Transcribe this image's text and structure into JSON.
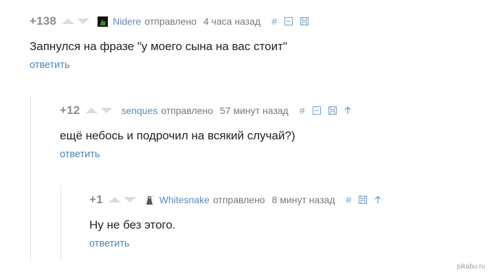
{
  "comments": [
    {
      "rating": "+138",
      "author": "Nidere",
      "meta": "отправлено",
      "time": "4 часа назад",
      "text": "Запнулся на фразе \"у моего сына на вас стоит\"",
      "reply": "ответить",
      "avatar_icon": "user-avatar-icon",
      "action_icons": [
        "link-hash-icon",
        "collapse-minus-icon",
        "save-floppy-icon"
      ]
    },
    {
      "rating": "+12",
      "author": "senques",
      "meta": "отправлено",
      "time": "57 минут назад",
      "text": "ещё небось и подрочил на всякий случай?)",
      "reply": "ответить",
      "action_icons": [
        "link-hash-icon",
        "collapse-minus-icon",
        "save-floppy-icon",
        "parent-arrow-icon"
      ]
    },
    {
      "rating": "+1",
      "author": "Whitesnake",
      "meta": "отправлено",
      "time": "8 минут назад",
      "text": "Ну не без этого.",
      "reply": "ответить",
      "avatar_icon": "user-avatar-icon",
      "action_icons": [
        "link-hash-icon",
        "save-floppy-icon",
        "parent-arrow-icon"
      ]
    }
  ],
  "watermark": "pikabu.ru",
  "colors": {
    "author": "#5b8ab8",
    "reply": "#4a86b9",
    "rating": "#8d8d8d",
    "vote_arrow": "#dcdcdc",
    "branch_line": "#e3e3e3"
  }
}
